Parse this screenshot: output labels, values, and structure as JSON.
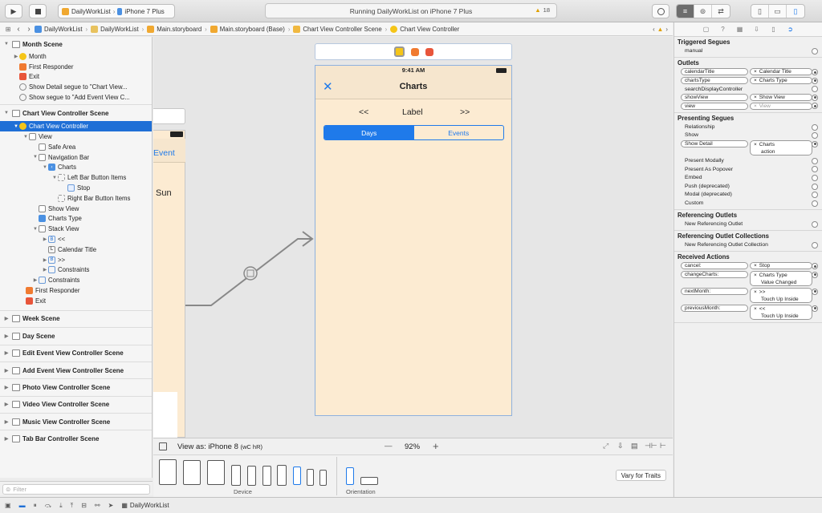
{
  "toolbar": {
    "scheme_app": "DailyWorkList",
    "scheme_device": "iPhone 7 Plus",
    "status_text": "Running DailyWorkList on iPhone 7 Plus",
    "warning_count": "18"
  },
  "jumpbar": {
    "crumbs": [
      "DailyWorkList",
      "DailyWorkList",
      "Main.storyboard",
      "Main.storyboard (Base)",
      "Chart View Controller Scene",
      "Chart View Controller"
    ]
  },
  "navigator": {
    "month_scene": "Month Scene",
    "month_items": [
      "Month",
      "First Responder",
      "Exit",
      "Show Detail segue to \"Chart View...",
      "Show segue to \"Add Event View C..."
    ],
    "chart_scene": "Chart View Controller Scene",
    "chart_vc": "Chart View Controller",
    "tree": {
      "view": "View",
      "safe_area": "Safe Area",
      "navigation_bar": "Navigation Bar",
      "charts": "Charts",
      "left_bar_items": "Left Bar Button Items",
      "stop": "Stop",
      "right_bar_items": "Right Bar Button Items",
      "show_view": "Show View",
      "charts_type": "Charts Type",
      "stack_view": "Stack View",
      "prev": "<<",
      "calendar_title": "Calendar Title",
      "next": ">>",
      "constraints_inner": "Constraints",
      "constraints": "Constraints",
      "first_responder": "First Responder",
      "exit": "Exit"
    },
    "scenes": [
      "Week Scene",
      "Day Scene",
      "Edit Event View Controller Scene",
      "Add Event View Controller Scene",
      "Photo View Controller Scene",
      "Video View Controller Scene",
      "Music View Controller Scene",
      "Tab Bar Controller Scene"
    ],
    "filter_placeholder": "Filter"
  },
  "canvas": {
    "left_scene_event": "Event",
    "left_scene_sun": "Sun",
    "phone": {
      "time": "9:41 AM",
      "title": "Charts",
      "prev": "<<",
      "label": "Label",
      "next": ">>",
      "seg_days": "Days",
      "seg_events": "Events"
    },
    "view_as": "View as: iPhone 8",
    "size_class": "(wC hR)",
    "zoom": "92%",
    "minus": "—",
    "plus": "+",
    "device_label": "Device",
    "orientation_label": "Orientation",
    "vary_button": "Vary for Traits"
  },
  "inspector": {
    "triggered_segues": "Triggered Segues",
    "manual": "manual",
    "outlets": "Outlets",
    "outlet_rows": [
      {
        "name": "calendarTitle",
        "target": "Calendar Title"
      },
      {
        "name": "chartsType",
        "target": "Charts Type"
      },
      {
        "name": "searchDisplayController",
        "target": ""
      },
      {
        "name": "showView",
        "target": "Show View"
      },
      {
        "name": "view",
        "target": "View"
      }
    ],
    "presenting_segues": "Presenting Segues",
    "segue_rows": [
      "Relationship",
      "Show",
      "Show Detail",
      "Present Modally",
      "Present As Popover",
      "Embed",
      "Push (deprecated)",
      "Modal (deprecated)",
      "Custom"
    ],
    "show_detail_target": "Charts",
    "show_detail_sub": "action",
    "referencing_outlets": "Referencing Outlets",
    "new_ref_outlet": "New Referencing Outlet",
    "referencing_outlet_collections": "Referencing Outlet Collections",
    "new_ref_collection": "New Referencing Outlet Collection",
    "received_actions": "Received Actions",
    "actions": [
      {
        "name": "cancel:",
        "target": "Stop",
        "event": ""
      },
      {
        "name": "changeCharts:",
        "target": "Charts Type",
        "event": "Value Changed"
      },
      {
        "name": "nextMonth:",
        "target": ">>",
        "event": "Touch Up Inside"
      },
      {
        "name": "previousMonth:",
        "target": "<<",
        "event": "Touch Up Inside"
      }
    ]
  },
  "debugbar": {
    "target": "DailyWorkList"
  },
  "colors": {
    "accent": "#1f6fd6",
    "scene_bg": "#fcebd2",
    "ios_blue": "#1f7aea"
  }
}
